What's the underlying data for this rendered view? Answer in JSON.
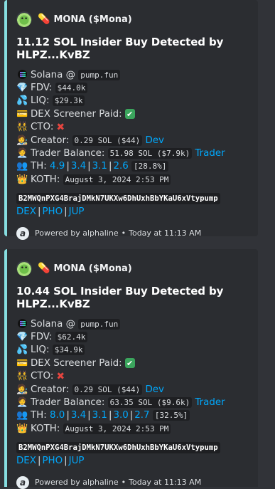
{
  "embeds": [
    {
      "author": "MONA ($Mona)",
      "title": "11.12 SOL Insider Buy Detected by HLPZ...KvBZ",
      "chain_label": "Solana @",
      "chain_value": "pump.fun",
      "fdv_label": "FDV:",
      "fdv_value": "$44.0k",
      "liq_label": "LIQ:",
      "liq_value": "$29.3k",
      "dex_paid_label": "DEX Screener Paid:",
      "dex_paid_icon": "check-icon",
      "cto_label": "CTO:",
      "cto_icon": "cross-icon",
      "creator_label": "Creator:",
      "creator_value": "0.29 SOL ($44)",
      "creator_link": "Dev",
      "trader_label": "Trader Balance:",
      "trader_value": "51.98 SOL ($7.9k)",
      "trader_link": "Trader",
      "th_label": "TH:",
      "th_values": [
        "4.9",
        "3.4",
        "3.1",
        "2.6"
      ],
      "th_total": "[28.8%]",
      "koth_label": "KOTH:",
      "koth_value": "August 3, 2024 2:53 PM",
      "contract": "B2MWQnPXG4BrajDMkN7UKXw6DhUxhBbYKaU6xVtypump",
      "links": [
        "DEX",
        "PHO",
        "JUP"
      ],
      "footer_text": "Powered by alphaline",
      "footer_time": "Today at 11:13 AM"
    },
    {
      "author": "MONA ($Mona)",
      "title": "10.44 SOL Insider Buy Detected by HLPZ...KvBZ",
      "chain_label": "Solana @",
      "chain_value": "pump.fun",
      "fdv_label": "FDV:",
      "fdv_value": "$62.4k",
      "liq_label": "LIQ:",
      "liq_value": "$34.9k",
      "dex_paid_label": "DEX Screener Paid:",
      "dex_paid_icon": "check-icon",
      "cto_label": "CTO:",
      "cto_icon": "cross-icon",
      "creator_label": "Creator:",
      "creator_value": "0.29 SOL ($44)",
      "creator_link": "Dev",
      "trader_label": "Trader Balance:",
      "trader_value": "63.35 SOL ($9.6k)",
      "trader_link": "Trader",
      "th_label": "TH:",
      "th_values": [
        "8.0",
        "3.4",
        "3.1",
        "3.0",
        "2.7"
      ],
      "th_total": "[32.5%]",
      "koth_label": "KOTH:",
      "koth_value": "August 3, 2024 2:53 PM",
      "contract": "B2MWQnPXG4BrajDMkN7UKXw6DhUxhBbYKaU6xVtypump",
      "links": [
        "DEX",
        "PHO",
        "JUP"
      ],
      "footer_text": "Powered by alphaline",
      "footer_time": "Today at 11:13 AM"
    }
  ],
  "colors": {
    "accent_border": "#86dde0",
    "link": "#00a8fc",
    "embed_bg": "#2b2d31"
  }
}
